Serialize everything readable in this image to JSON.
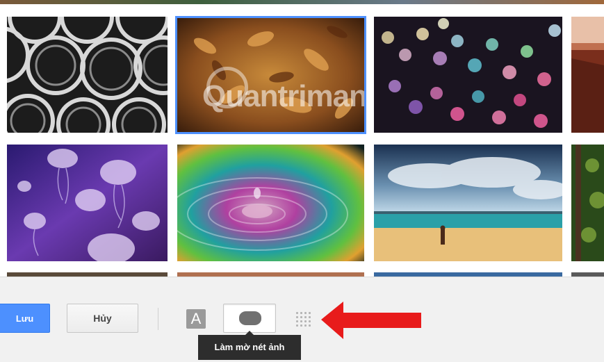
{
  "gallery": {
    "watermark_text": "Quantrimang",
    "tiles": [
      {
        "name": "tile-pipes",
        "selected": false
      },
      {
        "name": "tile-autumn-leaves",
        "selected": true
      },
      {
        "name": "tile-bokeh-lights",
        "selected": false
      },
      {
        "name": "tile-red-canyon",
        "selected": false
      },
      {
        "name": "tile-jellyfish",
        "selected": false
      },
      {
        "name": "tile-water-drop",
        "selected": false
      },
      {
        "name": "tile-beach",
        "selected": false
      },
      {
        "name": "tile-forest",
        "selected": false
      }
    ]
  },
  "toolbar": {
    "save_label": "Lưu",
    "cancel_label": "Hủy",
    "text_icon_glyph": "A",
    "tooltip_text": "Làm mờ nét ảnh"
  },
  "colors": {
    "accent": "#4d90fe",
    "arrow": "#e81b1b",
    "tooltip_bg": "#2d2d2d"
  }
}
